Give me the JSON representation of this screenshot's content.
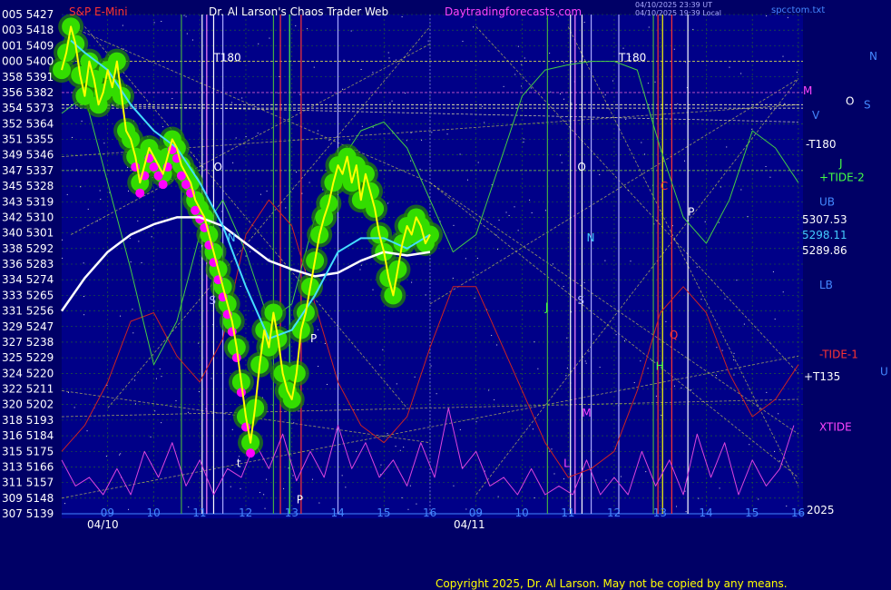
{
  "header": {
    "symbol": "S&P E-Mini",
    "author_title": "Dr. Al Larson's Chaos Trader Web",
    "site": "Daytradingforecasts.com",
    "timestamp_1": "04/10/2025 23:39 UT",
    "timestamp_2": "04/10/2025 19:39 Local",
    "file": "spcctom.txt"
  },
  "footer": {
    "copyright": "Copyright 2025, Dr. Al Larson. May not be copied by any means."
  },
  "colors": {
    "background": "#000066",
    "plot_bg": "#000088",
    "bubbles": "#33dd00",
    "price": "#ffff00",
    "ma_cyan": "#44ddff",
    "ma_white": "#ffffff",
    "tide": "#44cc44",
    "xtide": "#dd44dd",
    "red": "#cc2222",
    "magenta_dots": "#ff00ff"
  },
  "chart_data": {
    "type": "line",
    "y_axis_left": [
      {
        "deg": "005",
        "price": 5427
      },
      {
        "deg": "003",
        "price": 5418
      },
      {
        "deg": "001",
        "price": 5409
      },
      {
        "deg": "000",
        "price": 5400
      },
      {
        "deg": "358",
        "price": 5391
      },
      {
        "deg": "356",
        "price": 5382
      },
      {
        "deg": "354",
        "price": 5373
      },
      {
        "deg": "352",
        "price": 5364
      },
      {
        "deg": "351",
        "price": 5355
      },
      {
        "deg": "349",
        "price": 5346
      },
      {
        "deg": "347",
        "price": 5337
      },
      {
        "deg": "345",
        "price": 5328
      },
      {
        "deg": "343",
        "price": 5319
      },
      {
        "deg": "342",
        "price": 5310
      },
      {
        "deg": "340",
        "price": 5301
      },
      {
        "deg": "338",
        "price": 5292
      },
      {
        "deg": "336",
        "price": 5283
      },
      {
        "deg": "334",
        "price": 5274
      },
      {
        "deg": "333",
        "price": 5265
      },
      {
        "deg": "331",
        "price": 5256
      },
      {
        "deg": "329",
        "price": 5247
      },
      {
        "deg": "327",
        "price": 5238
      },
      {
        "deg": "325",
        "price": 5229
      },
      {
        "deg": "324",
        "price": 5220
      },
      {
        "deg": "322",
        "price": 5211
      },
      {
        "deg": "320",
        "price": 5202
      },
      {
        "deg": "318",
        "price": 5193
      },
      {
        "deg": "316",
        "price": 5184
      },
      {
        "deg": "315",
        "price": 5175
      },
      {
        "deg": "313",
        "price": 5166
      },
      {
        "deg": "311",
        "price": 5157
      },
      {
        "deg": "309",
        "price": 5148
      },
      {
        "deg": "307",
        "price": 5139
      }
    ],
    "ylim": [
      5139,
      5427
    ],
    "x_ticks": [
      {
        "label": "09",
        "t": 9
      },
      {
        "label": "10",
        "t": 10
      },
      {
        "label": "11",
        "t": 11
      },
      {
        "label": "12",
        "t": 12
      },
      {
        "label": "13",
        "t": 13
      },
      {
        "label": "14",
        "t": 14
      },
      {
        "label": "15",
        "t": 15
      },
      {
        "label": "16",
        "t": 16
      },
      {
        "label": "09",
        "t": 17
      },
      {
        "label": "10",
        "t": 18
      },
      {
        "label": "11",
        "t": 19
      },
      {
        "label": "12",
        "t": 20
      },
      {
        "label": "13",
        "t": 21
      },
      {
        "label": "14",
        "t": 22
      },
      {
        "label": "15",
        "t": 23
      },
      {
        "label": "16",
        "t": 24
      }
    ],
    "date_labels": [
      "04/10",
      "04/11"
    ],
    "xlim": [
      8.0,
      24.1
    ],
    "price_values": [
      {
        "label": "5307.53",
        "value": 5307.53
      },
      {
        "label": "5298.11",
        "value": 5298.11
      },
      {
        "label": "5289.86",
        "value": 5289.86
      }
    ],
    "right_labels": [
      {
        "label": "N",
        "price": 5403
      },
      {
        "label": "M",
        "price": 5383
      },
      {
        "label": "O",
        "price": 5377
      },
      {
        "label": "S",
        "price": 5375
      },
      {
        "label": "V",
        "price": 5369
      },
      {
        "label": "-T180",
        "price": 5352
      },
      {
        "label": "J",
        "price": 5341
      },
      {
        "label": "+TIDE-2",
        "price": 5333
      },
      {
        "label": "UB",
        "price": 5319
      },
      {
        "label": "LB",
        "price": 5271
      },
      {
        "label": "-TIDE-1",
        "price": 5231
      },
      {
        "label": "U",
        "price": 5221
      },
      {
        "label": "+T135",
        "price": 5218
      },
      {
        "label": "XTIDE",
        "price": 5189
      },
      {
        "label": "2025",
        "price": 5141
      }
    ],
    "annotations": [
      {
        "label": "T180",
        "t": 11.3,
        "price": 5400
      },
      {
        "label": "T180",
        "t": 20.1,
        "price": 5400
      },
      {
        "label": "O",
        "t": 11.3,
        "price": 5337
      },
      {
        "label": "N",
        "t": 11.6,
        "price": 5296
      },
      {
        "label": "S",
        "t": 11.2,
        "price": 5260
      },
      {
        "label": "P",
        "t": 13.4,
        "price": 5238
      },
      {
        "label": "O",
        "t": 19.2,
        "price": 5337
      },
      {
        "label": "N",
        "t": 19.4,
        "price": 5296
      },
      {
        "label": "S",
        "t": 19.2,
        "price": 5260
      },
      {
        "label": "J",
        "t": 18.5,
        "price": 5256
      },
      {
        "label": "C",
        "t": 21.0,
        "price": 5326
      },
      {
        "label": "P",
        "t": 21.6,
        "price": 5311
      },
      {
        "label": "Q",
        "t": 21.2,
        "price": 5240
      },
      {
        "label": "H",
        "t": 20.9,
        "price": 5222
      },
      {
        "label": "M",
        "t": 19.3,
        "price": 5195
      },
      {
        "label": "L",
        "t": 18.9,
        "price": 5166
      },
      {
        "label": "t",
        "t": 11.8,
        "price": 5166
      },
      {
        "label": "P",
        "t": 13.1,
        "price": 5145
      }
    ],
    "series": [
      {
        "name": "price",
        "x": [
          8.0,
          8.1,
          8.2,
          8.3,
          8.4,
          8.5,
          8.6,
          8.7,
          8.8,
          8.9,
          9.0,
          9.1,
          9.2,
          9.3,
          9.4,
          9.5,
          9.6,
          9.7,
          9.8,
          9.9,
          10.0,
          10.1,
          10.2,
          10.3,
          10.4,
          10.5,
          10.6,
          10.7,
          10.8,
          10.9,
          11.0,
          11.1,
          11.2,
          11.3,
          11.4,
          11.5,
          11.6,
          11.7,
          11.8,
          11.9,
          12.0,
          12.1,
          12.2,
          12.3,
          12.4,
          12.5,
          12.6,
          12.7,
          12.8,
          12.9,
          13.0,
          13.1,
          13.2,
          13.3,
          13.4,
          13.5,
          13.6,
          13.7,
          13.8,
          13.9,
          14.0,
          14.1,
          14.2,
          14.3,
          14.4,
          14.5,
          14.6,
          14.7,
          14.8,
          14.9,
          15.0,
          15.1,
          15.2,
          15.3,
          15.4,
          15.5,
          15.6,
          15.7,
          15.8,
          15.9,
          16.0
        ],
        "values": [
          5395,
          5405,
          5420,
          5410,
          5392,
          5380,
          5400,
          5390,
          5375,
          5382,
          5395,
          5385,
          5400,
          5380,
          5360,
          5355,
          5345,
          5330,
          5340,
          5350,
          5345,
          5340,
          5335,
          5345,
          5355,
          5350,
          5340,
          5335,
          5330,
          5320,
          5315,
          5310,
          5300,
          5290,
          5280,
          5270,
          5260,
          5250,
          5235,
          5215,
          5195,
          5180,
          5200,
          5225,
          5245,
          5235,
          5255,
          5240,
          5220,
          5210,
          5205,
          5220,
          5245,
          5255,
          5270,
          5285,
          5300,
          5310,
          5318,
          5330,
          5340,
          5335,
          5345,
          5330,
          5340,
          5320,
          5335,
          5325,
          5315,
          5300,
          5290,
          5275,
          5265,
          5280,
          5295,
          5305,
          5300,
          5310,
          5305,
          5295,
          5300
        ]
      },
      {
        "name": "ma-cyan",
        "x": [
          8.2,
          8.5,
          9.0,
          9.5,
          10.0,
          10.5,
          11.0,
          11.5,
          12.0,
          12.5,
          13.0,
          13.5,
          14.0,
          14.5,
          15.0,
          15.5,
          16.0
        ],
        "values": [
          5412,
          5405,
          5395,
          5375,
          5360,
          5350,
          5330,
          5305,
          5270,
          5240,
          5245,
          5265,
          5290,
          5298,
          5298,
          5292,
          5300
        ]
      },
      {
        "name": "ma-white",
        "x": [
          8.0,
          8.5,
          9.0,
          9.5,
          10.0,
          10.5,
          11.0,
          11.5,
          12.0,
          12.5,
          13.0,
          13.5,
          14.0,
          14.5,
          15.0,
          15.5,
          16.0
        ],
        "values": [
          5256,
          5275,
          5290,
          5300,
          5306,
          5310,
          5310,
          5305,
          5295,
          5285,
          5280,
          5276,
          5278,
          5285,
          5290,
          5288,
          5290
        ]
      },
      {
        "name": "tide-green",
        "x": [
          8.0,
          8.5,
          9.0,
          9.5,
          10.0,
          10.5,
          11.0,
          11.5,
          12.0,
          12.5,
          13.0,
          13.5,
          14.0,
          14.5,
          15.0,
          15.5,
          16.0,
          16.5,
          17.0,
          17.5,
          18.0,
          18.5,
          19.0,
          19.5,
          20.0,
          20.5,
          21.0,
          21.5,
          22.0,
          22.5,
          23.0,
          23.5,
          24.0
        ],
        "values": [
          5370,
          5380,
          5330,
          5280,
          5225,
          5250,
          5300,
          5320,
          5290,
          5250,
          5260,
          5310,
          5340,
          5360,
          5365,
          5350,
          5320,
          5290,
          5300,
          5340,
          5380,
          5395,
          5398,
          5400,
          5400,
          5395,
          5350,
          5310,
          5295,
          5320,
          5360,
          5350,
          5330
        ]
      },
      {
        "name": "red",
        "x": [
          8.0,
          8.5,
          9.0,
          9.5,
          10.0,
          10.5,
          11.0,
          11.5,
          12.0,
          12.5,
          13.0,
          13.5,
          14.0,
          14.5,
          15.0,
          15.5,
          16.0,
          16.5,
          17.0,
          17.5,
          18.0,
          18.5,
          19.0,
          19.5,
          20.0,
          20.5,
          21.0,
          21.5,
          22.0,
          22.5,
          23.0,
          23.5,
          24.0
        ],
        "values": [
          5175,
          5190,
          5215,
          5250,
          5255,
          5230,
          5215,
          5240,
          5300,
          5320,
          5305,
          5260,
          5215,
          5190,
          5180,
          5195,
          5235,
          5270,
          5270,
          5240,
          5210,
          5180,
          5160,
          5165,
          5175,
          5210,
          5255,
          5270,
          5255,
          5220,
          5195,
          5205,
          5225
        ]
      },
      {
        "name": "xtide",
        "x": [
          8.0,
          8.3,
          8.6,
          8.9,
          9.2,
          9.5,
          9.8,
          10.1,
          10.4,
          10.7,
          11.0,
          11.3,
          11.6,
          11.9,
          12.2,
          12.5,
          12.8,
          13.1,
          13.4,
          13.7,
          14.0,
          14.3,
          14.6,
          14.9,
          15.2,
          15.5,
          15.8,
          16.1,
          16.4,
          16.7,
          17.0,
          17.3,
          17.6,
          17.9,
          18.2,
          18.5,
          18.8,
          19.1,
          19.4,
          19.7,
          20.0,
          20.3,
          20.6,
          20.9,
          21.2,
          21.5,
          21.8,
          22.1,
          22.4,
          22.7,
          23.0,
          23.3,
          23.6,
          23.9
        ],
        "values": [
          5170,
          5155,
          5160,
          5150,
          5165,
          5150,
          5175,
          5160,
          5180,
          5155,
          5170,
          5150,
          5165,
          5160,
          5180,
          5165,
          5185,
          5158,
          5175,
          5160,
          5190,
          5165,
          5180,
          5160,
          5170,
          5155,
          5180,
          5160,
          5200,
          5165,
          5175,
          5155,
          5160,
          5150,
          5165,
          5150,
          5155,
          5150,
          5170,
          5150,
          5160,
          5150,
          5175,
          5155,
          5170,
          5150,
          5185,
          5160,
          5180,
          5150,
          5170,
          5155,
          5165,
          5190
        ]
      }
    ]
  }
}
